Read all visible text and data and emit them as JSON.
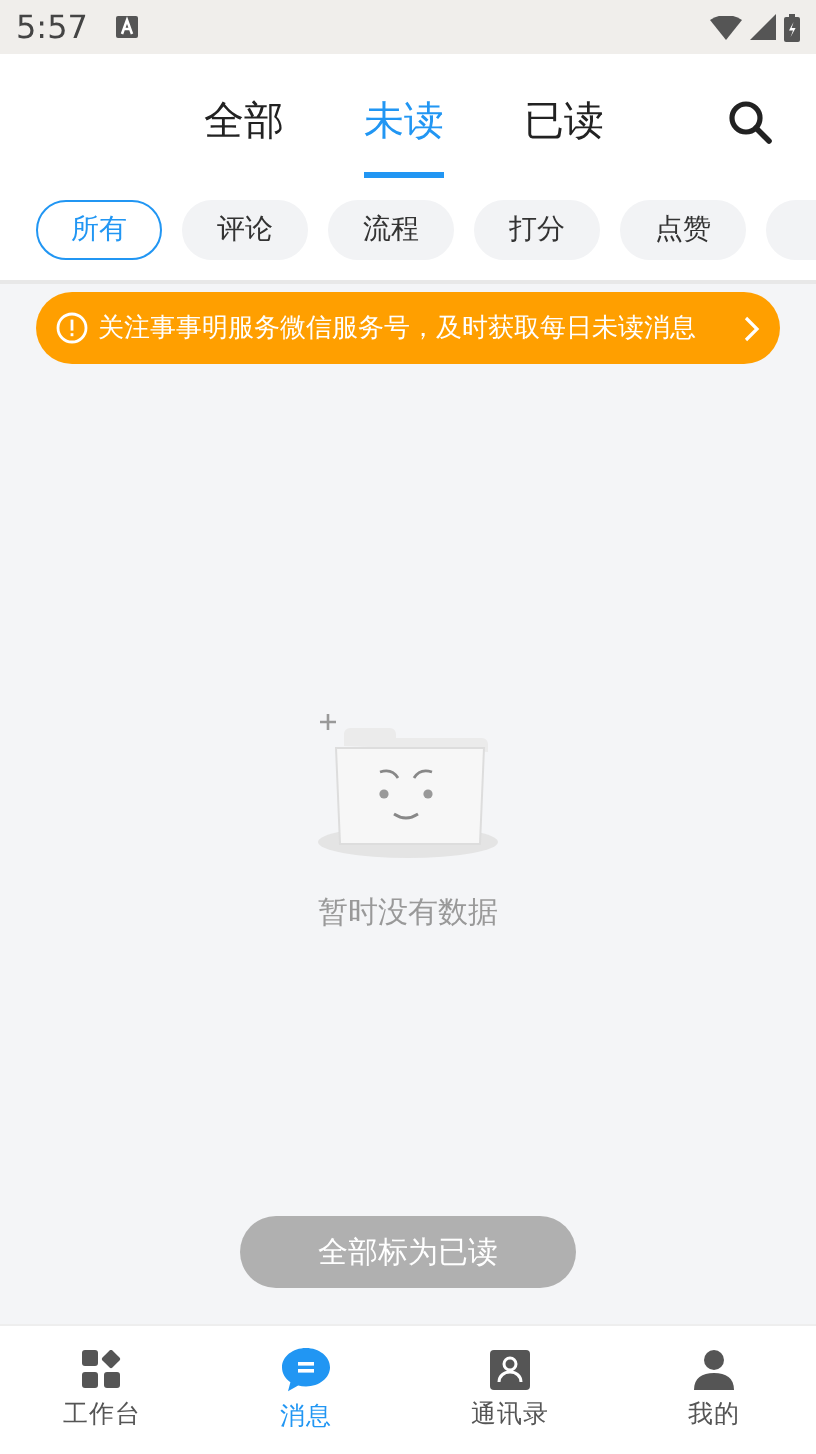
{
  "status_bar": {
    "time": "5:57"
  },
  "tabs": [
    {
      "label": "全部",
      "selected": false
    },
    {
      "label": "未读",
      "selected": true
    },
    {
      "label": "已读",
      "selected": false
    }
  ],
  "filters": [
    {
      "label": "所有",
      "selected": true
    },
    {
      "label": "评论",
      "selected": false
    },
    {
      "label": "流程",
      "selected": false
    },
    {
      "label": "打分",
      "selected": false
    },
    {
      "label": "点赞",
      "selected": false
    }
  ],
  "filters_overflow": true,
  "banner": {
    "text": "关注事事明服务微信服务号，及时获取每日未读消息"
  },
  "empty": {
    "text": "暂时没有数据"
  },
  "mark_all_button": {
    "label": "全部标为已读"
  },
  "bottom_nav": [
    {
      "label": "工作台",
      "kind": "grid",
      "selected": false
    },
    {
      "label": "消息",
      "kind": "chat",
      "selected": true
    },
    {
      "label": "通讯录",
      "kind": "contacts",
      "selected": false
    },
    {
      "label": "我的",
      "kind": "person",
      "selected": false
    }
  ]
}
